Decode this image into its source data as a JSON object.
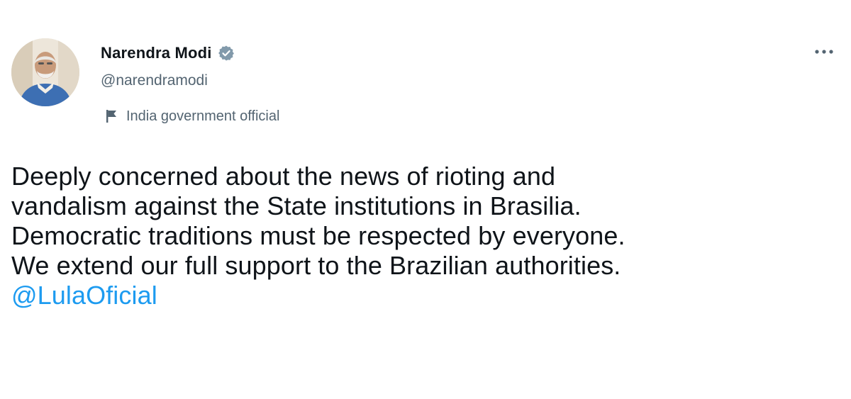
{
  "author": {
    "display_name": "Narendra Modi",
    "handle": "@narendramodi",
    "verified": true,
    "avatar_icon": "profile-photo",
    "affiliation_icon": "flag-icon",
    "affiliation_label": "India government official"
  },
  "menu": {
    "icon": "more-options-icon"
  },
  "tweet": {
    "lines": [
      "Deeply concerned about the news of rioting and",
      "vandalism against the State institutions in Brasilia.",
      "Democratic traditions must be respected by everyone.",
      "We extend our full support to the Brazilian authorities."
    ],
    "mention": "@LulaOficial"
  },
  "colors": {
    "text": "#0f1419",
    "secondary": "#536471",
    "link": "#1d9bf0",
    "verified_badge": "#829aab"
  }
}
